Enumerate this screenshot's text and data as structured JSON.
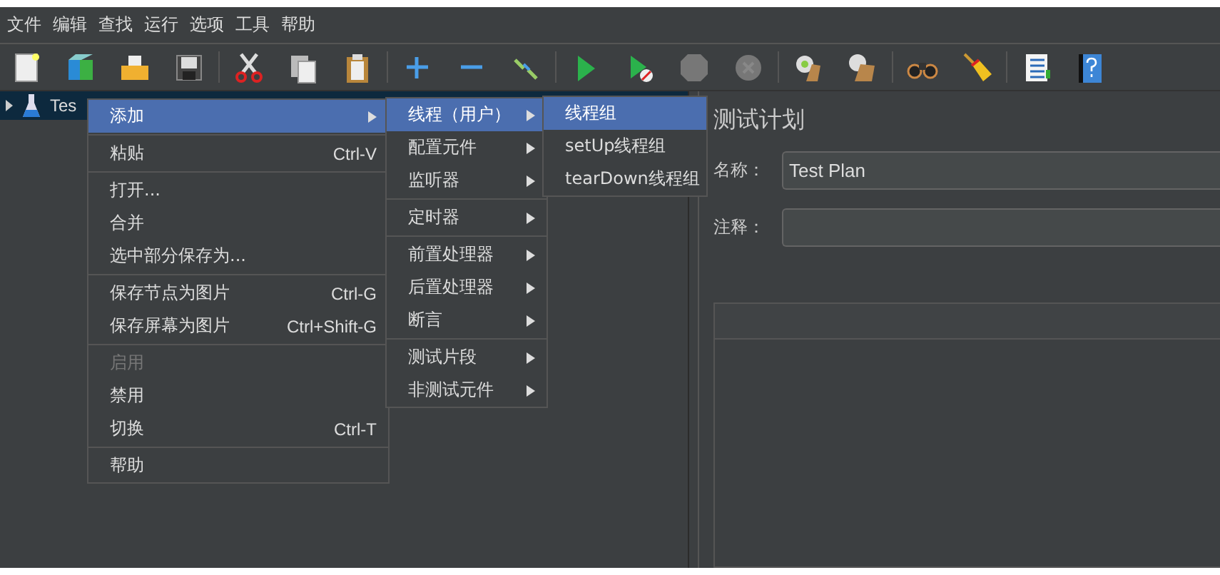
{
  "menu_bar": [
    {
      "label": "文件"
    },
    {
      "label": "编辑"
    },
    {
      "label": "查找"
    },
    {
      "label": "运行"
    },
    {
      "label": "选项"
    },
    {
      "label": "工具"
    },
    {
      "label": "帮助"
    }
  ],
  "tree": {
    "items": [
      {
        "label": "Tes",
        "selected": true,
        "expanded": false
      }
    ]
  },
  "context_menu": {
    "items": [
      {
        "kind": "item",
        "label": "添加",
        "submenu": true,
        "selected": true,
        "disabled": false
      },
      {
        "kind": "separator"
      },
      {
        "kind": "item",
        "label": "粘贴",
        "shortcut": "Ctrl-V",
        "submenu": false,
        "selected": false,
        "disabled": false
      },
      {
        "kind": "separator"
      },
      {
        "kind": "item",
        "label": "打开...",
        "submenu": false,
        "selected": false,
        "disabled": false
      },
      {
        "kind": "item",
        "label": "合并",
        "submenu": false,
        "selected": false,
        "disabled": false
      },
      {
        "kind": "item",
        "label": "选中部分保存为...",
        "submenu": false,
        "selected": false,
        "disabled": false
      },
      {
        "kind": "separator"
      },
      {
        "kind": "item",
        "label": "保存节点为图片",
        "shortcut": "Ctrl-G",
        "submenu": false,
        "selected": false,
        "disabled": false
      },
      {
        "kind": "item",
        "label": "保存屏幕为图片",
        "shortcut": "Ctrl+Shift-G",
        "submenu": false,
        "selected": false,
        "disabled": false
      },
      {
        "kind": "separator"
      },
      {
        "kind": "item",
        "label": "启用",
        "submenu": false,
        "selected": false,
        "disabled": true
      },
      {
        "kind": "item",
        "label": "禁用",
        "submenu": false,
        "selected": false,
        "disabled": false
      },
      {
        "kind": "item",
        "label": "切换",
        "shortcut": "Ctrl-T",
        "submenu": false,
        "selected": false,
        "disabled": false
      },
      {
        "kind": "separator"
      },
      {
        "kind": "item",
        "label": "帮助",
        "submenu": false,
        "selected": false,
        "disabled": false
      }
    ]
  },
  "add_submenu": {
    "items": [
      {
        "kind": "item",
        "label": "线程（用户）",
        "submenu": true,
        "selected": true,
        "disabled": false
      },
      {
        "kind": "item",
        "label": "配置元件",
        "submenu": true,
        "selected": false,
        "disabled": false
      },
      {
        "kind": "item",
        "label": "监听器",
        "submenu": true,
        "selected": false,
        "disabled": false
      },
      {
        "kind": "separator"
      },
      {
        "kind": "item",
        "label": "定时器",
        "submenu": true,
        "selected": false,
        "disabled": false
      },
      {
        "kind": "separator"
      },
      {
        "kind": "item",
        "label": "前置处理器",
        "submenu": true,
        "selected": false,
        "disabled": false
      },
      {
        "kind": "item",
        "label": "后置处理器",
        "submenu": true,
        "selected": false,
        "disabled": false
      },
      {
        "kind": "item",
        "label": "断言",
        "submenu": true,
        "selected": false,
        "disabled": false
      },
      {
        "kind": "separator"
      },
      {
        "kind": "item",
        "label": "测试片段",
        "submenu": true,
        "selected": false,
        "disabled": false
      },
      {
        "kind": "item",
        "label": "非测试元件",
        "submenu": true,
        "selected": false,
        "disabled": false
      }
    ]
  },
  "threads_submenu": {
    "items": [
      {
        "kind": "item",
        "label": "线程组",
        "submenu": false,
        "selected": true,
        "disabled": false
      },
      {
        "kind": "item",
        "label": "setUp线程组",
        "submenu": false,
        "selected": false,
        "disabled": false
      },
      {
        "kind": "item",
        "label": "tearDown线程组",
        "submenu": false,
        "selected": false,
        "disabled": false
      }
    ]
  },
  "panel": {
    "title": "测试计划",
    "fields": [
      {
        "label": "名称：",
        "value": "Test Plan"
      },
      {
        "label": "注释："
      }
    ]
  }
}
